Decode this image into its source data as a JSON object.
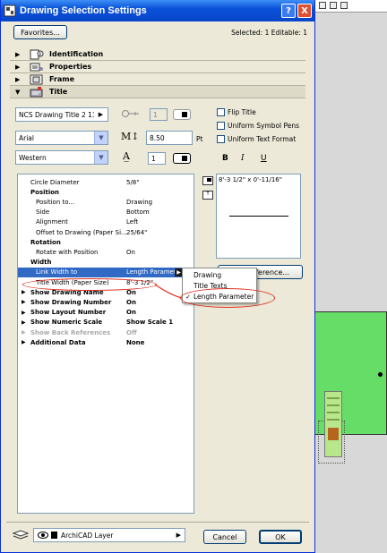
{
  "window": {
    "title": "Drawing Selection Settings",
    "help": "?",
    "close": "X"
  },
  "topbar": {
    "favorites_label": "Favorites...",
    "selection_info": "Selected: 1 Editable: 1"
  },
  "sections": [
    {
      "label": "Identification",
      "arrow": "▶",
      "icon": "info-icon"
    },
    {
      "label": "Properties",
      "arrow": "▶",
      "icon": "properties-icon"
    },
    {
      "label": "Frame",
      "arrow": "▶",
      "icon": "frame-icon"
    },
    {
      "label": "Title",
      "arrow": "▼",
      "icon": "title-icon"
    }
  ],
  "title_panel": {
    "title_type": "NCS Drawing Title 2 13",
    "title_type_arrow": "▶",
    "small_value": "1",
    "font": "Arial",
    "font_size": "8.50",
    "font_size_unit": "Pt",
    "encoding": "Western",
    "pen_value": "1",
    "size_glyph": "M↕",
    "pen_glyph": "A̲",
    "dd_arrow": "▼",
    "bold": "B",
    "italic": "I",
    "underline": "U",
    "flip_title": "Flip Title",
    "uniform_symbol_pens": "Uniform Symbol Pens",
    "uniform_text_format": "Uniform Text Format"
  },
  "params": [
    {
      "name": "Circle Diameter",
      "value": "5/8\"",
      "style": "normal",
      "indent": 1
    },
    {
      "name": "Position",
      "value": "",
      "style": "bold",
      "indent": 1
    },
    {
      "name": "Position to...",
      "value": "Drawing",
      "style": "normal",
      "indent": 2
    },
    {
      "name": "Side",
      "value": "Bottom",
      "style": "normal",
      "indent": 2
    },
    {
      "name": "Alignment",
      "value": "Left",
      "style": "normal",
      "indent": 2
    },
    {
      "name": "Offset to Drawing (Paper Si...",
      "value": "25/64\"",
      "style": "normal",
      "indent": 2
    },
    {
      "name": "Rotation",
      "value": "",
      "style": "bold",
      "indent": 1
    },
    {
      "name": "Rotate with Position",
      "value": "On",
      "style": "normal",
      "indent": 2
    },
    {
      "name": "Width",
      "value": "",
      "style": "bold",
      "indent": 1
    },
    {
      "name": "Link Width to",
      "value": "Length Paramete",
      "style": "selected",
      "indent": 2
    },
    {
      "name": "Title Width (Paper Size)",
      "value": "8'-3 1/2\"",
      "style": "normal",
      "indent": 2
    },
    {
      "name": "Show Drawing Name",
      "value": "On",
      "style": "boldtri",
      "indent": 1
    },
    {
      "name": "Show Drawing Number",
      "value": "On",
      "style": "boldtri",
      "indent": 1
    },
    {
      "name": "Show Layout Number",
      "value": "On",
      "style": "boldtri",
      "indent": 1
    },
    {
      "name": "Show Numeric Scale",
      "value": "Show Scale 1",
      "style": "boldtri",
      "indent": 1
    },
    {
      "name": "Show Back References",
      "value": "Off",
      "style": "greytri",
      "indent": 1
    },
    {
      "name": "Additional Data",
      "value": "None",
      "style": "boldtri",
      "indent": 1
    }
  ],
  "popup_arrow": "▶",
  "tri_glyph": "▶",
  "preview": {
    "text": "8'-3 1/2\" x 0'-11/16\"",
    "side_icon_2": "T"
  },
  "reference_button": "ference...",
  "menu": {
    "items": [
      {
        "label": "Drawing",
        "checked": false
      },
      {
        "label": "Title Texts",
        "checked": false
      },
      {
        "label": "Length Parameter",
        "checked": true
      }
    ],
    "check_glyph": "✓"
  },
  "bottom": {
    "layer": "ArchiCAD Layer",
    "layer_arrow": "▶",
    "cancel": "Cancel",
    "ok": "OK"
  },
  "colors": {
    "title_bar": "#0a52d8",
    "selection": "#316ac5",
    "annotation": "#e03020",
    "canvas_green": "#66dd66"
  }
}
